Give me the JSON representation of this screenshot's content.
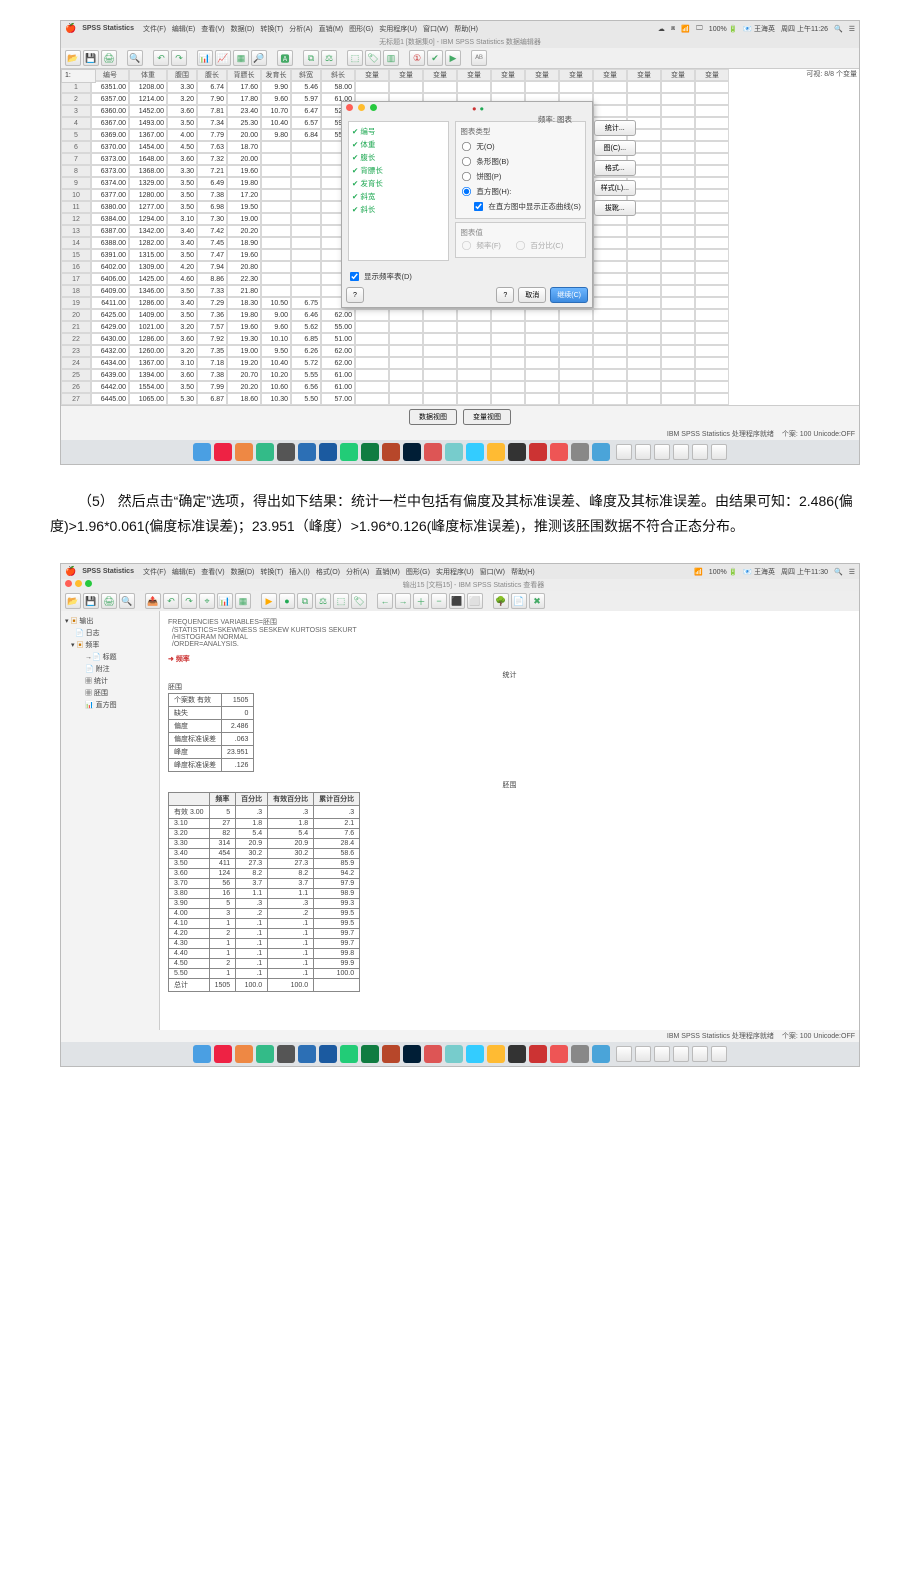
{
  "menubar": {
    "app": "SPSS Statistics",
    "items": [
      "文件(F)",
      "编辑(E)",
      "查看(V)",
      "数据(D)",
      "转换(T)",
      "分析(A)",
      "直销(M)",
      "图形(G)",
      "实用程序(U)",
      "窗口(W)",
      "帮助(H)"
    ],
    "right": [
      "100% 🔋",
      "📧 王海英",
      "周四 上午11:26"
    ]
  },
  "subtitle1": "无标题1 [数据集0] - IBM SPSS Statistics 数据编辑器",
  "visibleLabel": "可视: 8/8 个变量",
  "cornerLabel": "1:",
  "gridHeaders": [
    "编号",
    "体重",
    "腹围",
    "腹长",
    "背膘长",
    "发育长",
    "斜宽",
    "斜长"
  ],
  "extraHeader": "变量",
  "rows": [
    [
      1,
      "6351.00",
      "1208.00",
      "3.30",
      "6.74",
      "17.60",
      "9.90",
      "5.46",
      "58.00"
    ],
    [
      2,
      "6357.00",
      "1214.00",
      "3.20",
      "7.90",
      "17.80",
      "9.60",
      "5.97",
      "61.00"
    ],
    [
      3,
      "6360.00",
      "1452.00",
      "3.60",
      "7.81",
      "23.40",
      "10.70",
      "6.47",
      "52.00"
    ],
    [
      4,
      "6367.00",
      "1493.00",
      "3.50",
      "7.34",
      "25.30",
      "10.40",
      "6.57",
      "59.00"
    ],
    [
      5,
      "6369.00",
      "1367.00",
      "4.00",
      "7.79",
      "20.00",
      "9.80",
      "6.84",
      "55.00"
    ],
    [
      6,
      "6370.00",
      "1454.00",
      "4.50",
      "7.63",
      "18.70",
      "",
      "",
      ""
    ],
    [
      7,
      "6373.00",
      "1648.00",
      "3.60",
      "7.32",
      "20.00",
      "",
      "",
      ""
    ],
    [
      8,
      "6373.00",
      "1368.00",
      "3.30",
      "7.21",
      "19.60",
      "",
      "",
      ""
    ],
    [
      9,
      "6374.00",
      "1329.00",
      "3.50",
      "6.49",
      "19.80",
      "",
      "",
      ""
    ],
    [
      10,
      "6377.00",
      "1280.00",
      "3.50",
      "7.38",
      "17.20",
      "",
      "",
      ""
    ],
    [
      11,
      "6380.00",
      "1277.00",
      "3.50",
      "6.98",
      "19.50",
      "",
      "",
      ""
    ],
    [
      12,
      "6384.00",
      "1294.00",
      "3.10",
      "7.30",
      "19.00",
      "",
      "",
      ""
    ],
    [
      13,
      "6387.00",
      "1342.00",
      "3.40",
      "7.42",
      "20.20",
      "",
      "",
      ""
    ],
    [
      14,
      "6388.00",
      "1282.00",
      "3.40",
      "7.45",
      "18.90",
      "",
      "",
      ""
    ],
    [
      15,
      "6391.00",
      "1315.00",
      "3.50",
      "7.47",
      "19.60",
      "",
      "",
      ""
    ],
    [
      16,
      "6402.00",
      "1309.00",
      "4.20",
      "7.94",
      "20.80",
      "",
      "",
      ""
    ],
    [
      17,
      "6406.00",
      "1425.00",
      "4.60",
      "8.86",
      "22.30",
      "",
      "",
      ""
    ],
    [
      18,
      "6409.00",
      "1346.00",
      "3.50",
      "7.33",
      "21.80",
      "",
      "",
      ""
    ],
    [
      19,
      "6411.00",
      "1286.00",
      "3.40",
      "7.29",
      "18.30",
      "10.50",
      "6.75",
      ""
    ],
    [
      20,
      "6425.00",
      "1409.00",
      "3.50",
      "7.36",
      "19.80",
      "9.00",
      "6.46",
      "62.00"
    ],
    [
      21,
      "6429.00",
      "1021.00",
      "3.20",
      "7.57",
      "19.60",
      "9.60",
      "5.62",
      "55.00"
    ],
    [
      22,
      "6430.00",
      "1286.00",
      "3.60",
      "7.92",
      "19.30",
      "10.10",
      "6.85",
      "51.00"
    ],
    [
      23,
      "6432.00",
      "1260.00",
      "3.20",
      "7.35",
      "19.00",
      "9.50",
      "6.26",
      "62.00"
    ],
    [
      24,
      "6434.00",
      "1367.00",
      "3.10",
      "7.18",
      "19.20",
      "10.40",
      "5.72",
      "62.00"
    ],
    [
      25,
      "6439.00",
      "1394.00",
      "3.60",
      "7.38",
      "20.70",
      "10.20",
      "5.55",
      "61.00"
    ],
    [
      26,
      "6442.00",
      "1554.00",
      "3.50",
      "7.99",
      "20.20",
      "10.60",
      "6.56",
      "61.00"
    ],
    [
      27,
      "6445.00",
      "1065.00",
      "5.30",
      "6.87",
      "18.60",
      "10.30",
      "5.50",
      "57.00"
    ]
  ],
  "modal": {
    "title": "频率: 图表",
    "vars": [
      "编号",
      "体重",
      "腹长",
      "背膘长",
      "发育长",
      "斜宽",
      "斜长"
    ],
    "groupTitle": "图表类型",
    "opts": {
      "none": "无(O)",
      "bar": "条形图(B)",
      "pie": "饼图(P)",
      "hist": "直方图(H):"
    },
    "histCheck": "在直方图中显示正态曲线(S)",
    "showTable": "显示频率表(D)",
    "valGroup": "图表值",
    "valOpts": {
      "freq": "频率(F)",
      "pct": "百分比(C)"
    },
    "side": [
      "统计...",
      "图(C)...",
      "格式...",
      "样式(L)...",
      "拔靴..."
    ],
    "btns": {
      "help": "?",
      "cancel": "取消",
      "ok": "继续(C)",
      "semihelp": "?"
    }
  },
  "footerTabs": {
    "data": "数据视图",
    "var": "变量视图"
  },
  "status": {
    "proc": "IBM SPSS Statistics 处理程序就绪",
    "cases": "个案: 100  Unicode:OFF"
  },
  "taskbarColors": [
    "#4a9fe3",
    "#e24",
    "#e84",
    "#3b8",
    "#555",
    "#2c6fb5",
    "#1b5aa0",
    "#2c7",
    "#107c41",
    "#b7472a",
    "#001e36",
    "#d55",
    "#7cc",
    "#3cf",
    "#fb3",
    "#333",
    "#c33",
    "#e55",
    "#888",
    "#4aa4d9"
  ],
  "paragraph": "（5） 然后点击“确定”选项，得出如下结果：统计一栏中包括有偏度及其标准误差、峰度及其标准误差。由结果可知：2.486(偏度)>1.96*0.061(偏度标准误差)；23.951（峰度）>1.96*0.126(峰度标准误差)，推测该胚围数据不符合正态分布。",
  "viewer": {
    "subtitle": "输出15 [文档15] - IBM SPSS Statistics 查看器",
    "menuExtras": [
      "插入(I)",
      "格式(O)"
    ],
    "tree": {
      "root": "输出",
      "log": "日志",
      "freq": "频率",
      "sub": [
        "标题",
        "附注",
        "统计",
        "胚围",
        "直方图"
      ]
    },
    "syntax": [
      "FREQUENCIES VARIABLES=胚围",
      "  /STATISTICS=SKEWNESS SESKEW KURTOSIS SEKURT",
      "  /HISTOGRAM NORMAL",
      "  /ORDER=ANALYSIS."
    ],
    "marker": "频率",
    "statsTitle": "统计",
    "statsVar": "胚围",
    "stats": [
      [
        "个案数  有效",
        "1505"
      ],
      [
        "         缺失",
        "0"
      ],
      [
        "偏度",
        "2.486"
      ],
      [
        "偏度标准误差",
        ".063"
      ],
      [
        "峰度",
        "23.951"
      ],
      [
        "峰度标准误差",
        ".126"
      ]
    ],
    "freqTitle": "胚围",
    "freqHeaders": [
      "",
      "频率",
      "百分比",
      "有效百分比",
      "累计百分比"
    ],
    "freqRows": [
      [
        "有效  3.00",
        "5",
        ".3",
        ".3",
        ".3"
      ],
      [
        "3.10",
        "27",
        "1.8",
        "1.8",
        "2.1"
      ],
      [
        "3.20",
        "82",
        "5.4",
        "5.4",
        "7.6"
      ],
      [
        "3.30",
        "314",
        "20.9",
        "20.9",
        "28.4"
      ],
      [
        "3.40",
        "454",
        "30.2",
        "30.2",
        "58.6"
      ],
      [
        "3.50",
        "411",
        "27.3",
        "27.3",
        "85.9"
      ],
      [
        "3.60",
        "124",
        "8.2",
        "8.2",
        "94.2"
      ],
      [
        "3.70",
        "56",
        "3.7",
        "3.7",
        "97.9"
      ],
      [
        "3.80",
        "16",
        "1.1",
        "1.1",
        "98.9"
      ],
      [
        "3.90",
        "5",
        ".3",
        ".3",
        "99.3"
      ],
      [
        "4.00",
        "3",
        ".2",
        ".2",
        "99.5"
      ],
      [
        "4.10",
        "1",
        ".1",
        ".1",
        "99.5"
      ],
      [
        "4.20",
        "2",
        ".1",
        ".1",
        "99.7"
      ],
      [
        "4.30",
        "1",
        ".1",
        ".1",
        "99.7"
      ],
      [
        "4.40",
        "1",
        ".1",
        ".1",
        "99.8"
      ],
      [
        "4.50",
        "2",
        ".1",
        ".1",
        "99.9"
      ],
      [
        "5.50",
        "1",
        ".1",
        ".1",
        "100.0"
      ],
      [
        "总计",
        "1505",
        "100.0",
        "100.0",
        ""
      ]
    ]
  }
}
